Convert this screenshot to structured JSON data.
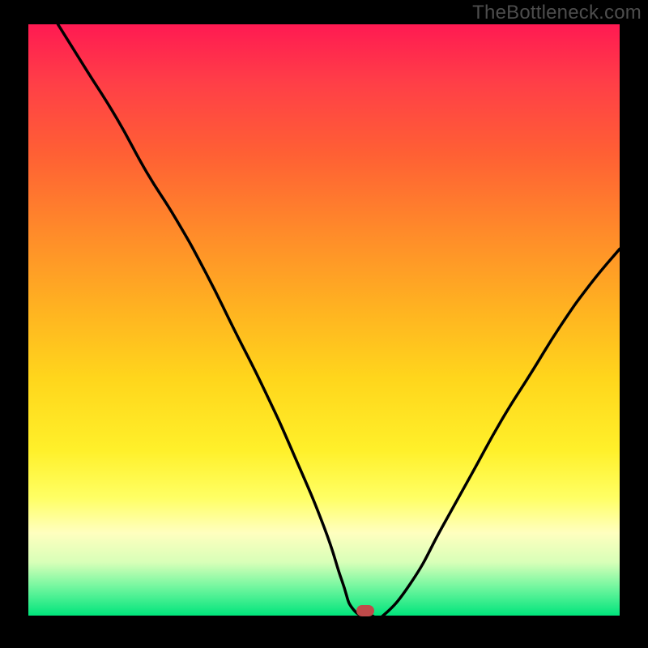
{
  "watermark": "TheBottleneck.com",
  "colors": {
    "frame": "#000000",
    "gradient_top": "#ff1a52",
    "gradient_bottom": "#00e47c",
    "curve": "#000000",
    "marker": "#bf4a4a",
    "watermark": "#4d4d4d"
  },
  "marker": {
    "x_pct": 57.0,
    "y_pct": 99.2
  },
  "chart_data": {
    "type": "line",
    "title": "",
    "xlabel": "",
    "ylabel": "",
    "xlim": [
      0,
      100
    ],
    "ylim": [
      0,
      100
    ],
    "x": [
      5,
      10,
      15,
      20,
      25,
      30,
      35,
      40,
      45,
      50,
      53,
      55,
      58,
      60,
      65,
      70,
      75,
      80,
      85,
      90,
      95,
      100
    ],
    "values": [
      100,
      92,
      84,
      75,
      67,
      58,
      48,
      38,
      27,
      15,
      6,
      1,
      0,
      0,
      6,
      15,
      24,
      33,
      41,
      49,
      56,
      62
    ],
    "series": [
      {
        "name": "bottleneck-curve",
        "x": [
          5,
          10,
          15,
          20,
          25,
          30,
          35,
          40,
          45,
          50,
          53,
          55,
          58,
          60,
          65,
          70,
          75,
          80,
          85,
          90,
          95,
          100
        ],
        "values": [
          100,
          92,
          84,
          75,
          67,
          58,
          48,
          38,
          27,
          15,
          6,
          1,
          0,
          0,
          6,
          15,
          24,
          33,
          41,
          49,
          56,
          62
        ]
      }
    ],
    "annotations": [
      {
        "name": "optimal-marker",
        "x": 57,
        "y": 0.8
      }
    ]
  }
}
